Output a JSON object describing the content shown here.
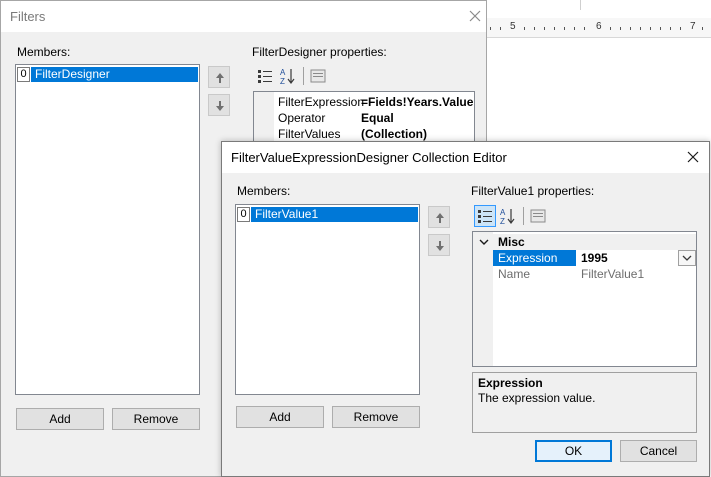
{
  "ruler": {
    "labels": [
      "5",
      "6",
      "7"
    ]
  },
  "filters_dialog": {
    "title": "Filters",
    "members_label": "Members:",
    "members": [
      {
        "index": "0",
        "name": "FilterDesigner"
      }
    ],
    "properties_label": "FilterDesigner properties:",
    "properties": [
      {
        "name": "FilterExpression",
        "value": "=Fields!Years.Value"
      },
      {
        "name": "Operator",
        "value": "Equal"
      },
      {
        "name": "FilterValues",
        "value": "(Collection)"
      }
    ],
    "add_label": "Add",
    "remove_label": "Remove"
  },
  "collection_editor": {
    "title": "FilterValueExpressionDesigner Collection Editor",
    "members_label": "Members:",
    "members": [
      {
        "index": "0",
        "name": "FilterValue1"
      }
    ],
    "properties_label": "FilterValue1 properties:",
    "category": "Misc",
    "properties": [
      {
        "name": "Expression",
        "value": "1995"
      },
      {
        "name": "Name",
        "value": "FilterValue1"
      }
    ],
    "description_title": "Expression",
    "description_text": "The expression value.",
    "add_label": "Add",
    "remove_label": "Remove",
    "ok_label": "OK",
    "cancel_label": "Cancel"
  },
  "colors": {
    "selection": "#0078d7",
    "accent_border": "#0078d7"
  }
}
